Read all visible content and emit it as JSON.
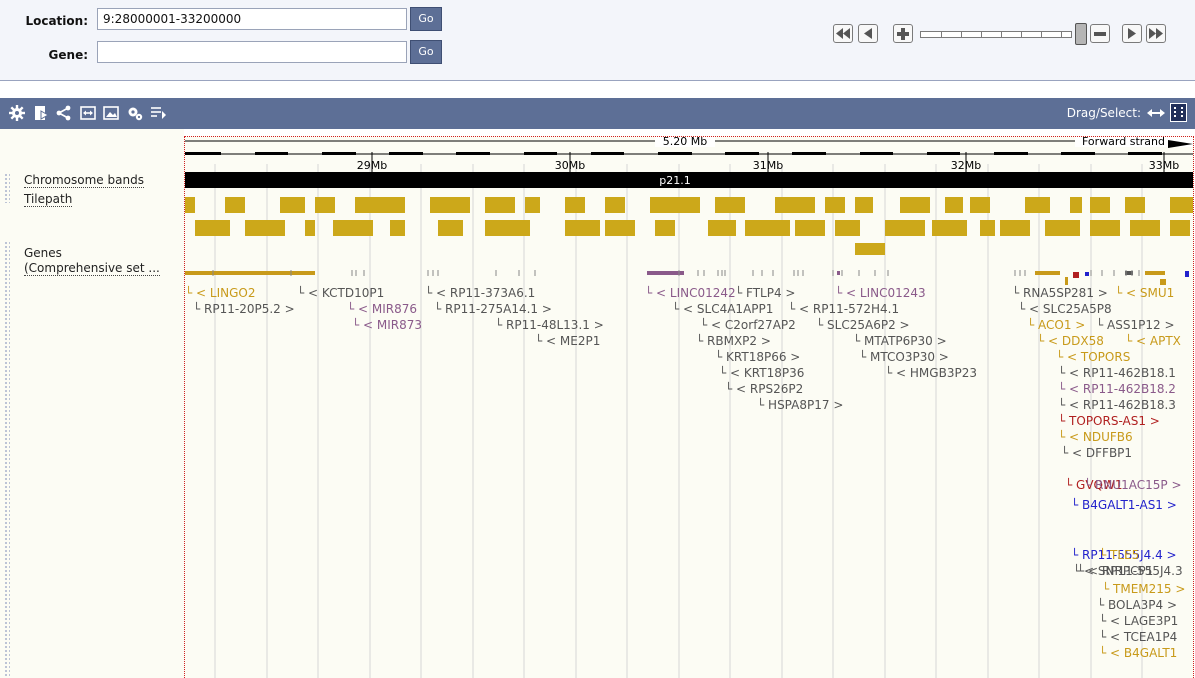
{
  "form": {
    "location_label": "Location:",
    "location_value": "9:28000001-33200000",
    "gene_label": "Gene:",
    "gene_value": "",
    "go_label": "Go"
  },
  "toolbar": {
    "drag_select_label": "Drag/Select:",
    "tools": [
      "settings-icon",
      "export-icon",
      "share-icon",
      "resize-icon",
      "image-export-icon",
      "reset-tracks-icon",
      "reorder-tracks-icon"
    ]
  },
  "ruler": {
    "span_label": "5.20 Mb",
    "strand_label": "Forward strand",
    "ticks": [
      "29Mb",
      "30Mb",
      "31Mb",
      "32Mb",
      "33Mb"
    ]
  },
  "tracks": {
    "chromosome_bands": "Chromosome bands",
    "tilepath": "Tilepath",
    "genes_line1": "Genes",
    "genes_line2": "(Comprehensive set ..."
  },
  "band_label": "p21.1",
  "colors": {
    "toolbar": "#5d6f96",
    "tilepath": "#cca81a",
    "gene_grey": "#555555",
    "gene_gold": "#c89a1a",
    "gene_purple": "#8a5a8a",
    "gene_red": "#b02020",
    "gene_blue": "#2222cc"
  },
  "genes": [
    {
      "label": "└ < LINGO2",
      "color": "gold"
    },
    {
      "label": "└ RP11-20P5.2 >",
      "color": "grey"
    },
    {
      "label": "└ < KCTD10P1",
      "color": "grey"
    },
    {
      "label": "└ < MIR876",
      "color": "purple"
    },
    {
      "label": "└ < MIR873",
      "color": "purple"
    },
    {
      "label": "└ < RP11-373A6.1",
      "color": "grey"
    },
    {
      "label": "└ RP11-275A14.1 >",
      "color": "grey"
    },
    {
      "label": "└ RP11-48L13.1 >",
      "color": "grey"
    },
    {
      "label": "└ < ME2P1",
      "color": "grey"
    },
    {
      "label": "└ < LINC01242",
      "color": "purple"
    },
    {
      "label": "└ FTLP4 >",
      "color": "grey"
    },
    {
      "label": "└ < LINC01243",
      "color": "purple"
    },
    {
      "label": "└ < SLC4A1APP1",
      "color": "grey"
    },
    {
      "label": "└ < RP11-572H4.1",
      "color": "grey"
    },
    {
      "label": "└ < C2orf27AP2",
      "color": "grey"
    },
    {
      "label": "└ SLC25A6P2 >",
      "color": "grey"
    },
    {
      "label": "└ RBMXP2 >",
      "color": "grey"
    },
    {
      "label": "└ MTATP6P30 >",
      "color": "grey"
    },
    {
      "label": "└ KRT18P66 >",
      "color": "grey"
    },
    {
      "label": "└ MTCO3P30 >",
      "color": "grey"
    },
    {
      "label": "└ < KRT18P36",
      "color": "grey"
    },
    {
      "label": "└ < HMGB3P23",
      "color": "grey"
    },
    {
      "label": "└ < RPS26P2",
      "color": "grey"
    },
    {
      "label": "└ HSPA8P17 >",
      "color": "grey"
    },
    {
      "label": "└ RNA5SP281 >",
      "color": "grey"
    },
    {
      "label": "└ < SMU1",
      "color": "gold"
    },
    {
      "label": "└ < SLC25A5P8",
      "color": "grey"
    },
    {
      "label": "└ ACO1 >",
      "color": "gold"
    },
    {
      "label": "└ ASS1P12 >",
      "color": "grey"
    },
    {
      "label": "└ < DDX58",
      "color": "gold"
    },
    {
      "label": "└ < APTX",
      "color": "gold"
    },
    {
      "label": "└ < TOPORS",
      "color": "gold"
    },
    {
      "label": "└ < RP11-462B18.1",
      "color": "grey"
    },
    {
      "label": "└ < RP11-462B18.2",
      "color": "purple"
    },
    {
      "label": "└ < RP11-462B18.3",
      "color": "grey"
    },
    {
      "label": "└ TOPORS-AS1 >",
      "color": "red"
    },
    {
      "label": "└ < NDUFB6",
      "color": "gold"
    },
    {
      "label": "└ < DFFBP1",
      "color": "grey"
    },
    {
      "label": "└ GVQW1",
      "color": "red"
    },
    {
      "label": "└ RNU1AC15P >",
      "color": "purple"
    },
    {
      "label": "└ B4GALT1-AS1 >",
      "color": "blue"
    },
    {
      "label": "└ RP11-555J4.4 >",
      "color": "blue"
    },
    {
      "label": "└ TLE5",
      "color": "gold"
    },
    {
      "label": "└ < SNRPCP1",
      "color": "grey"
    },
    {
      "label": "└ < RP11-555J4.3",
      "color": "grey"
    },
    {
      "label": "└ TMEM215 >",
      "color": "gold"
    },
    {
      "label": "└ BOLA3P4 >",
      "color": "grey"
    },
    {
      "label": "└ < LAGE3P1",
      "color": "grey"
    },
    {
      "label": "└ < TCEA1P4",
      "color": "grey"
    },
    {
      "label": "└ < B4GALT1",
      "color": "gold"
    }
  ]
}
